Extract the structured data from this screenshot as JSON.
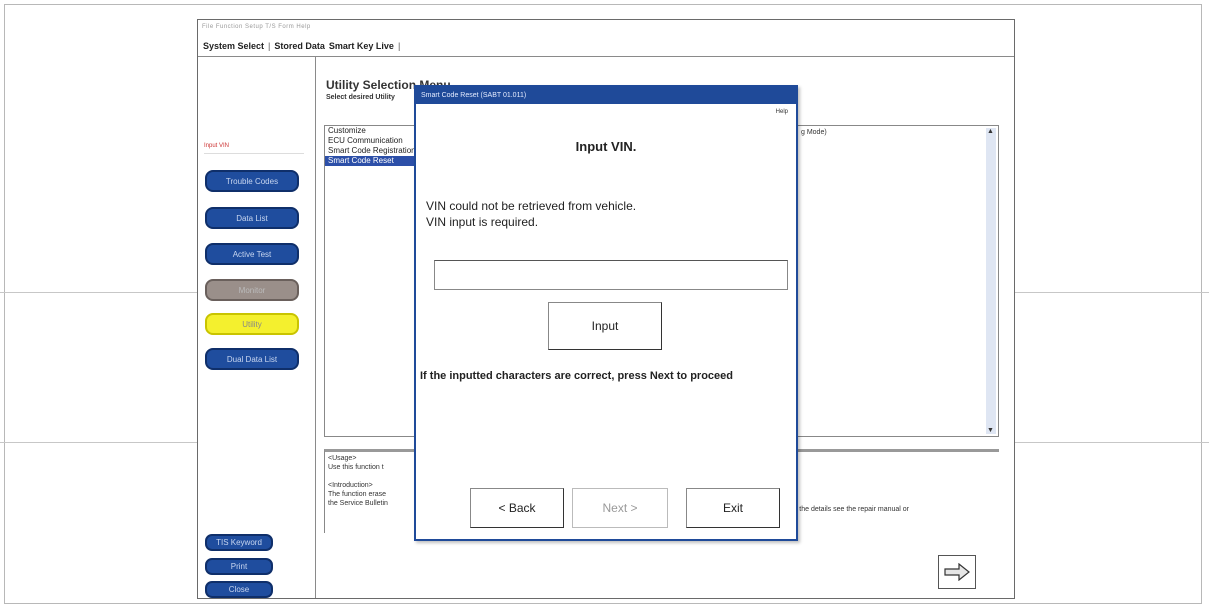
{
  "menu": {
    "strip": "File  Function  Setup  T/S  Form  Help"
  },
  "tabs": [
    {
      "label": "System Select"
    },
    {
      "label": "Stored Data"
    },
    {
      "label": "Smart Key Live"
    }
  ],
  "sidebar": {
    "label": "Input VIN",
    "buttons": [
      {
        "label": "Trouble Codes"
      },
      {
        "label": "Data List"
      },
      {
        "label": "Active Test"
      },
      {
        "label": "Monitor"
      },
      {
        "label": "Utility"
      },
      {
        "label": "Dual Data List"
      }
    ],
    "bottom_buttons": [
      {
        "label": "TIS Keyword"
      },
      {
        "label": "Print"
      },
      {
        "label": "Close"
      }
    ]
  },
  "main": {
    "title": "Utility Selection Menu",
    "subtitle": "Select desired Utility",
    "list_items": [
      {
        "label": "Customize"
      },
      {
        "label": "ECU Communication"
      },
      {
        "label": "Smart Code Registration"
      },
      {
        "label": "Smart Code Reset"
      }
    ],
    "list_right_text": "g Mode)",
    "usage_lines": [
      "<Usage>",
      "Use this function t",
      "",
      "<Introduction>",
      "The function erase",
      "the Service Bulletin"
    ],
    "usage_right_text": "r the details see the repair manual or"
  },
  "dialog": {
    "title": "Smart Code Reset (SABT 01.011)",
    "help": "Help",
    "heading": "Input VIN.",
    "message_line1": "VIN could not be retrieved from vehicle.",
    "message_line2": "VIN input is required.",
    "vin_value": "",
    "input_button": "Input",
    "message2": "If the inputted characters are correct, press Next to proceed",
    "back_button": "< Back",
    "next_button": "Next >",
    "exit_button": "Exit"
  }
}
